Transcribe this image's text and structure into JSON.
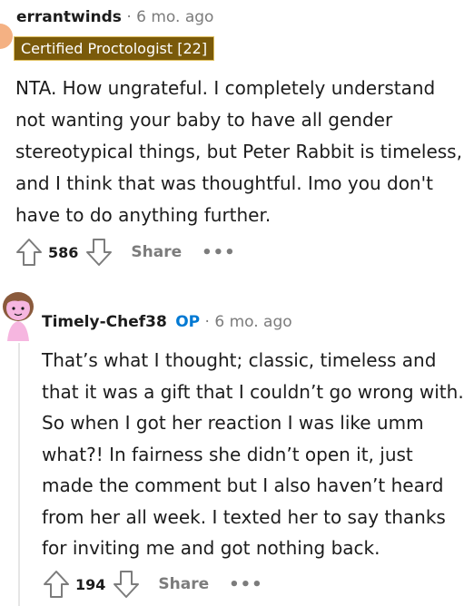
{
  "comment1": {
    "author": "errantwinds",
    "separator": "·",
    "time": "6 mo. ago",
    "flair": "Certified Proctologist [22]",
    "body": "NTA. How ungrateful. I completely understand not wanting your baby to have all gender stereotypical things, but Peter Rabbit is timeless, and I think that was thoughtful. Imo you don't have to do anything further.",
    "votes": "586",
    "share_label": "Share",
    "more_label": "•••"
  },
  "comment2": {
    "author": "Timely-Chef38",
    "op_badge": "OP",
    "separator": "·",
    "time": "6 mo. ago",
    "body": "That’s what I thought; classic, timeless and that it was a gift that I couldn’t go wrong with. So when I got her reaction I was like umm what?! In fairness she didn’t open it, just made the comment but I also haven’t heard from her all week. I texted her to say thanks for inviting me and got nothing back.",
    "votes": "194",
    "share_label": "Share",
    "more_label": "•••"
  },
  "colors": {
    "flair_bg": "#7a5a0a",
    "op": "#0079d3",
    "muted": "#7c7c7c",
    "avatar_pink": "#f6b6e0"
  },
  "icons": [
    "upvote-icon",
    "downvote-icon",
    "avatar-icon"
  ]
}
